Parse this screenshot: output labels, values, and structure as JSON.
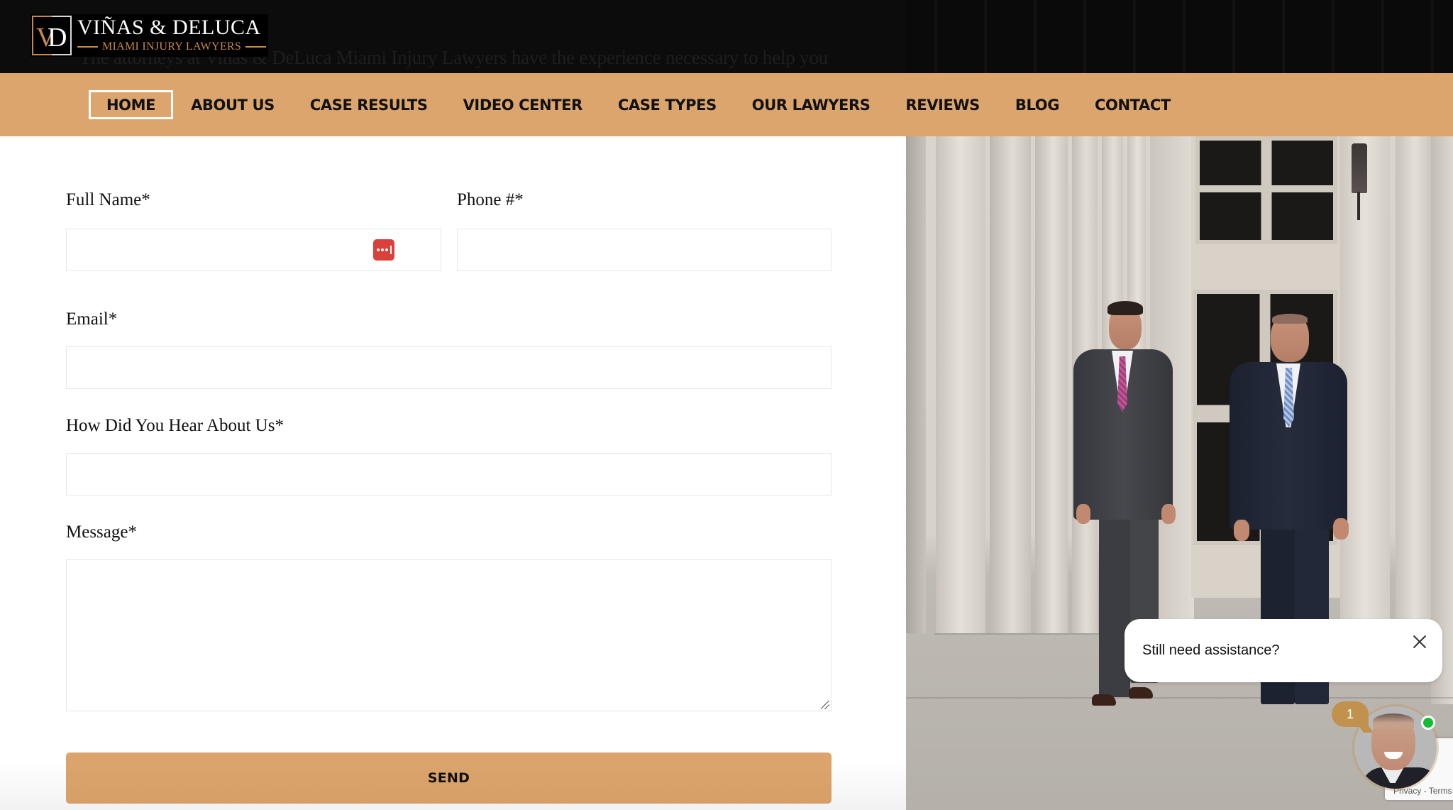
{
  "header": {
    "logo": {
      "monogram_left": "V",
      "monogram_right": "D",
      "title": "VIÑAS & DELUCA",
      "subtitle": "MIAMI INJURY LAWYERS"
    },
    "background_text": "The attorneys at Viñas & DeLuca Miami Injury Lawyers have the experience necessary to help you"
  },
  "nav": {
    "items": [
      {
        "label": "HOME",
        "active": true
      },
      {
        "label": "ABOUT US",
        "active": false
      },
      {
        "label": "CASE RESULTS",
        "active": false
      },
      {
        "label": "VIDEO CENTER",
        "active": false
      },
      {
        "label": "CASE TYPES",
        "active": false
      },
      {
        "label": "OUR LAWYERS",
        "active": false
      },
      {
        "label": "REVIEWS",
        "active": false
      },
      {
        "label": "BLOG",
        "active": false
      },
      {
        "label": "CONTACT",
        "active": false
      }
    ]
  },
  "form": {
    "full_name": {
      "label": "Full Name*",
      "value": "",
      "placeholder": ""
    },
    "phone": {
      "label": "Phone #*",
      "value": "",
      "placeholder": ""
    },
    "email": {
      "label": "Email*",
      "value": "",
      "placeholder": ""
    },
    "referral": {
      "label": "How Did You Hear About Us*",
      "value": "",
      "placeholder": ""
    },
    "message": {
      "label": "Message*",
      "value": "",
      "placeholder": ""
    },
    "password_manager_icon": "password-manager-icon",
    "submit_label": "SEND"
  },
  "chat": {
    "prompt": "Still need assistance?",
    "unread_count": "1",
    "status": "online"
  },
  "recaptcha": {
    "privacy": "Privacy",
    "separator": " - ",
    "terms": "Terms"
  },
  "colors": {
    "accent": "#dca56d",
    "header_bg": "#0c0c0c",
    "logo_copper": "#c8884a",
    "badge": "#c0924d",
    "online": "#0fbf2f",
    "password_icon": "#d9413c"
  }
}
